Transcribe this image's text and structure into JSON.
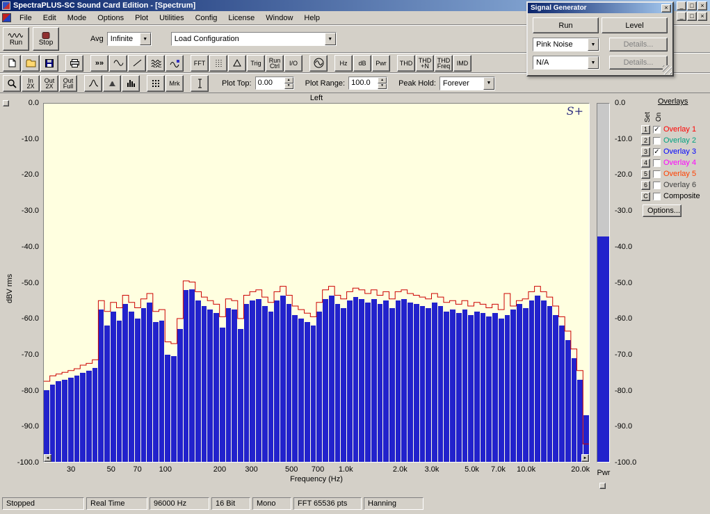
{
  "window": {
    "title": "SpectraPLUS-SC Sound Card Edition - [Spectrum]",
    "controls": {
      "minimize": "_",
      "maximize": "□",
      "close": "×"
    }
  },
  "ui_glyphs": {
    "up": "▲",
    "down": "▼",
    "dropdown": "▼"
  },
  "menu": {
    "items": [
      "File",
      "Edit",
      "Mode",
      "Options",
      "Plot",
      "Utilities",
      "Config",
      "License",
      "Window",
      "Help"
    ]
  },
  "toolbar_main": {
    "run_label": "Run",
    "stop_label": "Stop",
    "avg_label": "Avg",
    "avg_value": "Infinite",
    "config_value": "Load Configuration"
  },
  "toolbar_icons": {
    "items": [
      {
        "name": "new-file-button",
        "icon": "doc"
      },
      {
        "name": "open-file-button",
        "icon": "folder"
      },
      {
        "name": "save-button",
        "icon": "disk"
      },
      {
        "kind": "gap"
      },
      {
        "name": "print-button",
        "icon": "printer"
      },
      {
        "kind": "gap"
      },
      {
        "name": "fast-forward-button",
        "glyph": "»»"
      },
      {
        "name": "wave-scroll-button",
        "icon": "sine"
      },
      {
        "name": "slope-button",
        "icon": "slope"
      },
      {
        "name": "multi-wave-button",
        "icon": "waves"
      },
      {
        "name": "wave-print-button",
        "icon": "wave-pen"
      },
      {
        "kind": "gap"
      },
      {
        "name": "fft-settings-button",
        "label": "FFT"
      },
      {
        "name": "sampling-button",
        "icon": "dotted-cols"
      },
      {
        "name": "peak-curve-button",
        "icon": "delta"
      },
      {
        "name": "trigger-button",
        "label": "Trig"
      },
      {
        "name": "run-control-button",
        "label": "Run\nCtrl"
      },
      {
        "name": "io-button",
        "label": "I/O"
      },
      {
        "kind": "gap"
      },
      {
        "name": "signal-generator-button",
        "icon": "sine-circle"
      },
      {
        "kind": "gap"
      },
      {
        "name": "hz-button",
        "label": "Hz"
      },
      {
        "name": "db-button",
        "label": "dB"
      },
      {
        "name": "pwr-button",
        "label": "Pwr"
      },
      {
        "kind": "gap"
      },
      {
        "name": "thd-button",
        "label": "THD"
      },
      {
        "name": "thd-n-button",
        "label": "THD\n+N"
      },
      {
        "name": "thd-freq-button",
        "label": "THD\nFreq"
      },
      {
        "name": "imd-button",
        "label": "IMD"
      }
    ]
  },
  "toolbar_view": {
    "items": [
      {
        "name": "zoom-button",
        "icon": "magnifier"
      },
      {
        "name": "zoom-in-2x-button",
        "label": "In\n2X"
      },
      {
        "name": "zoom-out-2x-button",
        "label": "Out\n2X"
      },
      {
        "name": "zoom-out-full-button",
        "label": "Out\nFull"
      },
      {
        "kind": "gap"
      },
      {
        "name": "line-plot-button",
        "icon": "curve"
      },
      {
        "name": "filled-plot-button",
        "icon": "curve-small"
      },
      {
        "name": "bar-plot-button",
        "icon": "bars"
      },
      {
        "kind": "gap"
      },
      {
        "name": "spectrogram-button",
        "icon": "grid"
      },
      {
        "name": "marker-button",
        "label": "Mrk"
      },
      {
        "kind": "gap"
      },
      {
        "name": "cursor-button",
        "icon": "ibeam"
      }
    ],
    "plot_top_label": "Plot Top:",
    "plot_top_value": "0.00",
    "plot_range_label": "Plot Range:",
    "plot_range_value": "100.0",
    "peak_hold_label": "Peak Hold:",
    "peak_hold_value": "Forever"
  },
  "plot": {
    "title": "Left",
    "ylabel": "dBV rms",
    "xlabel": "Frequency (Hz)",
    "logo": "S+",
    "scroll_left": "◄",
    "scroll_right": "►",
    "y_ticks": [
      "0.0",
      "-10.0",
      "-20.0",
      "-30.0",
      "-40.0",
      "-50.0",
      "-60.0",
      "-70.0",
      "-80.0",
      "-90.0",
      "-100.0"
    ],
    "x_ticks": [
      {
        "label": "30",
        "hz": 30
      },
      {
        "label": "50",
        "hz": 50
      },
      {
        "label": "70",
        "hz": 70
      },
      {
        "label": "100",
        "hz": 100
      },
      {
        "label": "200",
        "hz": 200
      },
      {
        "label": "300",
        "hz": 300
      },
      {
        "label": "500",
        "hz": 500
      },
      {
        "label": "700",
        "hz": 700
      },
      {
        "label": "1.0k",
        "hz": 1000
      },
      {
        "label": "2.0k",
        "hz": 2000
      },
      {
        "label": "3.0k",
        "hz": 3000
      },
      {
        "label": "5.0k",
        "hz": 5000
      },
      {
        "label": "7.0k",
        "hz": 7000
      },
      {
        "label": "10.0k",
        "hz": 10000
      },
      {
        "label": "20.0k",
        "hz": 20000
      }
    ]
  },
  "chart_data": {
    "type": "bar",
    "title": "Left",
    "xlabel": "Frequency (Hz)",
    "ylabel": "dBV rms",
    "x_scale": "log",
    "x_range_hz": [
      21,
      22500
    ],
    "ylim": [
      -100,
      0
    ],
    "background": "#ffffe0",
    "grid": false,
    "series": [
      {
        "name": "Live pink-noise spectrum",
        "type": "bar",
        "color": "#2222cc",
        "values": [
          -80,
          -78.5,
          -77.5,
          -77,
          -76.5,
          -76,
          -75.2,
          -74.5,
          -73.8,
          -57.5,
          -62,
          -58,
          -60.5,
          -56,
          -58,
          -60,
          -57,
          -55.5,
          -61,
          -60.5,
          -70,
          -70.5,
          -63,
          -52,
          -51.8,
          -55,
          -56.5,
          -57.5,
          -58.5,
          -62.5,
          -57,
          -57.5,
          -63,
          -56,
          -55,
          -54.5,
          -56.5,
          -58,
          -55,
          -53.5,
          -56,
          -59,
          -60,
          -61,
          -62,
          -58,
          -54.5,
          -53.5,
          -56,
          -57,
          -55,
          -54,
          -54.5,
          -55.5,
          -54.5,
          -56,
          -55,
          -57,
          -55,
          -54.5,
          -55.5,
          -56,
          -56.5,
          -57,
          -55.5,
          -56.5,
          -58,
          -57.5,
          -58.5,
          -57.5,
          -59,
          -58,
          -58.5,
          -59.5,
          -58.5,
          -60,
          -59,
          -57.5,
          -56,
          -57,
          -55,
          -53.5,
          -55,
          -56.5,
          -59,
          -62,
          -66,
          -71,
          -77,
          -87
        ]
      },
      {
        "name": "Peak hold (Overlay 1)",
        "type": "step-line",
        "color": "#cc0000",
        "values": [
          -77.5,
          -76,
          -75.5,
          -75,
          -74.5,
          -74,
          -73,
          -72.5,
          -71.5,
          -55,
          -58,
          -55.5,
          -57,
          -53.5,
          -55.5,
          -57,
          -54.5,
          -53,
          -58,
          -57.5,
          -66.5,
          -67,
          -60,
          -49.5,
          -49.8,
          -52.5,
          -54,
          -55,
          -56,
          -59.5,
          -54.5,
          -55,
          -60,
          -53.5,
          -52.5,
          -52,
          -54,
          -55.5,
          -52.5,
          -51,
          -53.5,
          -56.5,
          -57.5,
          -58.5,
          -59.5,
          -55.5,
          -52,
          -51,
          -53.5,
          -54.5,
          -52.5,
          -51.5,
          -52,
          -53,
          -52,
          -53.5,
          -52.5,
          -54.5,
          -52.5,
          -52,
          -53,
          -53.5,
          -54,
          -54.5,
          -53,
          -54,
          -55.5,
          -55,
          -56,
          -55,
          -56.5,
          -55.5,
          -56,
          -57,
          -56,
          -57.5,
          -53,
          -56.5,
          -55,
          -54.5,
          -52.5,
          -51,
          -52.5,
          -54,
          -56.5,
          -59.5,
          -63.5,
          -68.5,
          -74.5,
          -95
        ]
      }
    ]
  },
  "meter": {
    "label": "Pwr",
    "value_db": -37,
    "min_db": -100,
    "max_db": 0,
    "color": "#2222cc"
  },
  "overlays": {
    "title": "Overlays",
    "set_header": "Set",
    "on_header": "On",
    "check_glyph": "✓",
    "rows": [
      {
        "num": "1",
        "label": "Overlay 1",
        "color": "#ff0000",
        "checked": true
      },
      {
        "num": "2",
        "label": "Overlay 2",
        "color": "#00a080",
        "checked": false
      },
      {
        "num": "3",
        "label": "Overlay 3",
        "color": "#0000ff",
        "checked": true
      },
      {
        "num": "4",
        "label": "Overlay 4",
        "color": "#ff00ff",
        "checked": false
      },
      {
        "num": "5",
        "label": "Overlay 5",
        "color": "#ff4000",
        "checked": false
      },
      {
        "num": "6",
        "label": "Overlay 6",
        "color": "#404040",
        "checked": false
      },
      {
        "num": "C",
        "label": "Composite",
        "color": "#000000",
        "checked": false
      }
    ],
    "options_label": "Options..."
  },
  "signal_generator": {
    "title": "Signal Generator",
    "close_glyph": "×",
    "run_label": "Run",
    "level_label": "Level",
    "source_value": "Pink Noise",
    "source_details_label": "Details...",
    "mod_value": "N/A",
    "mod_details_label": "Details..."
  },
  "status_bar": {
    "items": [
      "Stopped",
      "Real Time",
      "96000 Hz",
      "16 Bit",
      "Mono",
      "FFT 65536 pts",
      "Hanning"
    ]
  }
}
